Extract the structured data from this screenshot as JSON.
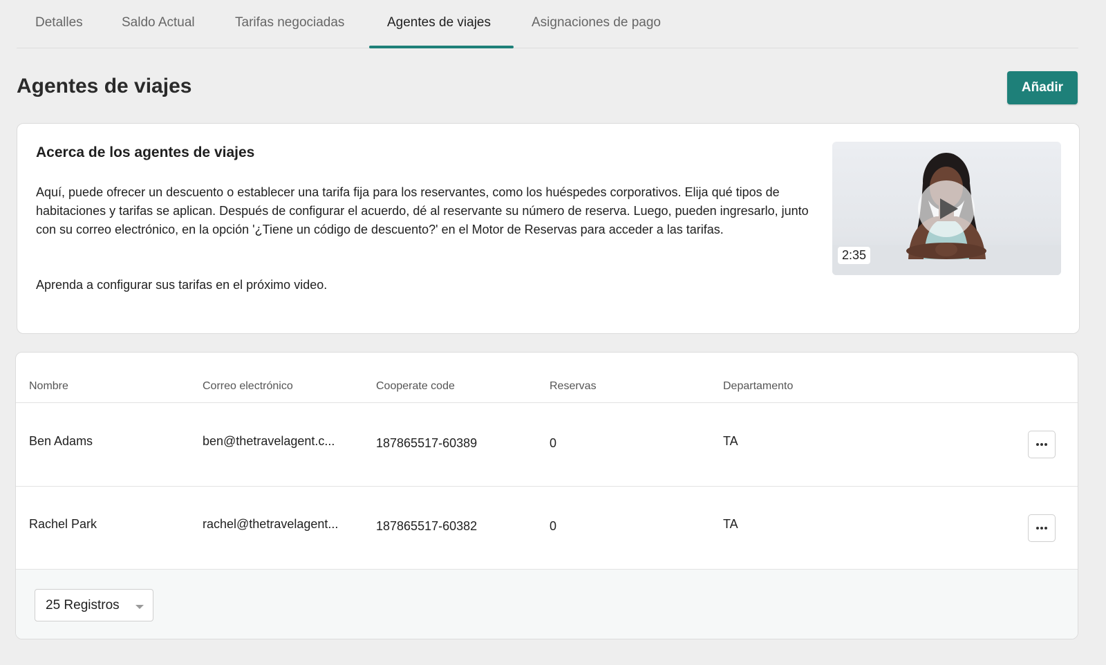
{
  "tabs": [
    {
      "label": "Detalles",
      "active": false
    },
    {
      "label": "Saldo Actual",
      "active": false
    },
    {
      "label": "Tarifas negociadas",
      "active": false
    },
    {
      "label": "Agentes de viajes",
      "active": true
    },
    {
      "label": "Asignaciones de pago",
      "active": false
    }
  ],
  "page": {
    "title": "Agentes de viajes",
    "add_label": "Añadir"
  },
  "info": {
    "title": "Acerca de los agentes de viajes",
    "paragraph1": "Aquí, puede ofrecer un descuento o establecer una tarifa fija para los reservantes, como los huéspedes corporativos. Elija qué tipos de habitaciones y tarifas se aplican. Después de configurar el acuerdo, dé al reservante su número de reserva. Luego, pueden ingresarlo, junto con su correo electrónico, en la opción '¿Tiene un código de descuento?' en el Motor de Reservas para acceder a las tarifas.",
    "paragraph2": "Aprenda a configurar sus tarifas en el próximo video.",
    "video_duration": "2:35",
    "video_icon": "play-icon"
  },
  "table": {
    "headers": [
      "Nombre",
      "Correo electrónico",
      "Cooperate code",
      "Reservas",
      "Departamento"
    ],
    "rows": [
      {
        "name": "Ben Adams",
        "email": "ben@thetravelagent.c...",
        "code": "187865517-60389",
        "bookings": "0",
        "department": "TA"
      },
      {
        "name": "Rachel Park",
        "email": "rachel@thetravelagent...",
        "code": "187865517-60382",
        "bookings": "0",
        "department": "TA"
      }
    ],
    "page_size": "25 Registros"
  },
  "colors": {
    "accent": "#1e8079",
    "background": "#eeeeee",
    "card": "#ffffff"
  }
}
